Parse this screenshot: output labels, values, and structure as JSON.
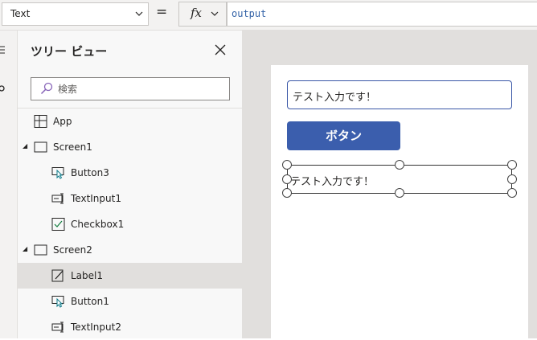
{
  "formula_bar": {
    "property": "Text",
    "equals": "=",
    "fx": "fx",
    "formula": "output"
  },
  "tree_view": {
    "title": "ツリー ビュー",
    "search_placeholder": "検索",
    "items": [
      {
        "label": "App",
        "icon": "app-icon",
        "level": 0
      },
      {
        "label": "Screen1",
        "icon": "screen-icon",
        "level": 0,
        "expanded": true
      },
      {
        "label": "Button3",
        "icon": "button-icon",
        "level": 1
      },
      {
        "label": "TextInput1",
        "icon": "text-input-icon",
        "level": 1
      },
      {
        "label": "Checkbox1",
        "icon": "checkbox-icon",
        "level": 1
      },
      {
        "label": "Screen2",
        "icon": "screen-icon",
        "level": 0,
        "expanded": true
      },
      {
        "label": "Label1",
        "icon": "label-icon",
        "level": 1,
        "selected": true
      },
      {
        "label": "Button1",
        "icon": "button-icon",
        "level": 1
      },
      {
        "label": "TextInput2",
        "icon": "text-input-icon",
        "level": 1
      }
    ]
  },
  "canvas": {
    "text_input_value": "テスト入力です！",
    "button_label": "ボタン",
    "label_text": "テスト入力です！"
  },
  "colors": {
    "accent": "#3b5ead",
    "formula_text": "#3463a7",
    "selected_row": "#e1dfdd",
    "canvas_bg": "#e1dfdd"
  }
}
